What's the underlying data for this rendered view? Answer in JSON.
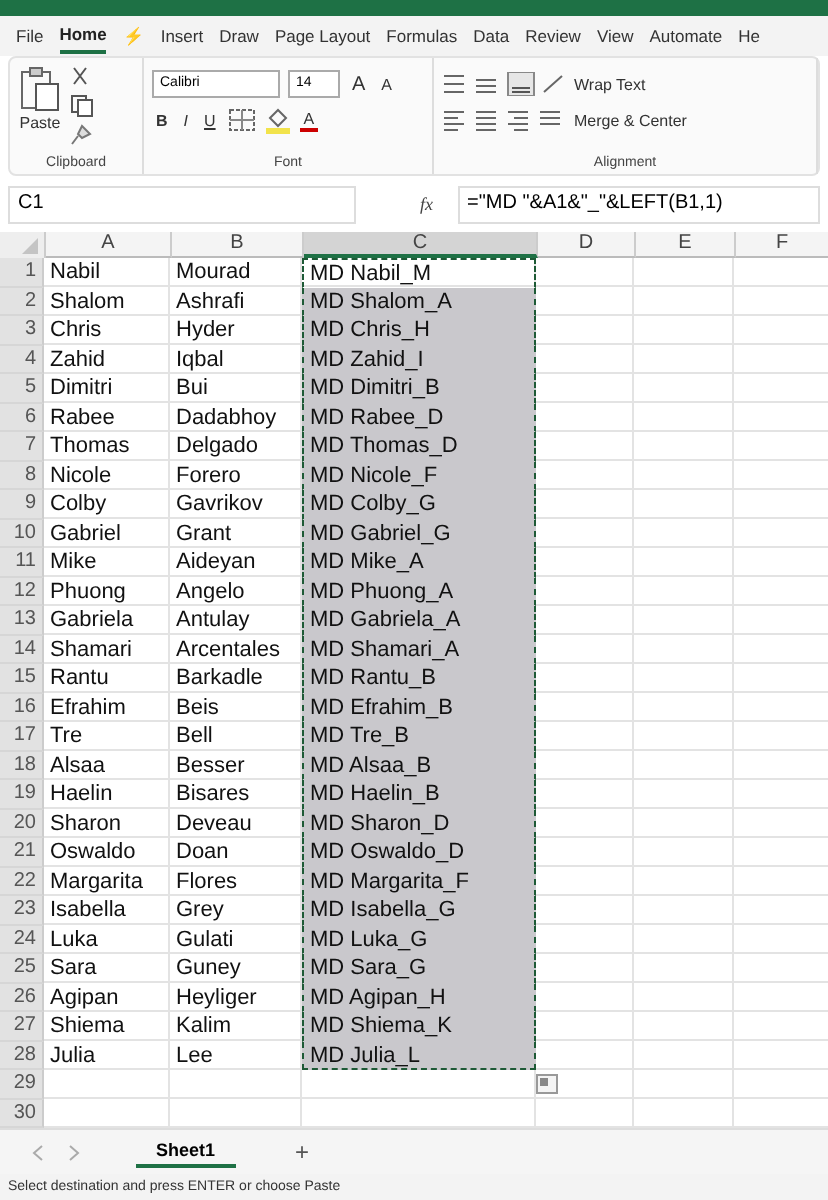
{
  "ribbon_tabs": [
    {
      "label": "File",
      "selected": false
    },
    {
      "label": "Home",
      "selected": true
    },
    {
      "label": "⚡",
      "selected": false
    },
    {
      "label": "Insert",
      "selected": false
    },
    {
      "label": "Draw",
      "selected": false
    },
    {
      "label": "Page Layout",
      "selected": false
    },
    {
      "label": "Formulas",
      "selected": false
    },
    {
      "label": "Data",
      "selected": false
    },
    {
      "label": "Review",
      "selected": false
    },
    {
      "label": "View",
      "selected": false
    },
    {
      "label": "Automate",
      "selected": false
    },
    {
      "label": "He",
      "selected": false
    }
  ],
  "clipboard": {
    "paste": "Paste",
    "group": "Clipboard"
  },
  "font": {
    "name": "Calibri",
    "size": "14",
    "grow": "A",
    "shrink": "A",
    "style_buttons": [
      "B",
      "I",
      "U"
    ],
    "color_button": "A",
    "group": "Font"
  },
  "alignment": {
    "wrap": "Wrap Text",
    "merge": "Merge & Center",
    "group": "Alignment"
  },
  "formula_bar": {
    "name_box": "C1",
    "fx": "fx",
    "formula": "=\"MD \"&A1&\"_\"&LEFT(B1,1)"
  },
  "columns": [
    {
      "label": "A",
      "selected": false
    },
    {
      "label": "B",
      "selected": false
    },
    {
      "label": "C",
      "selected": true
    },
    {
      "label": "D",
      "selected": false
    },
    {
      "label": "E",
      "selected": false
    },
    {
      "label": "F",
      "selected": false
    }
  ],
  "rows": [
    {
      "n": "1",
      "a": "Nabil",
      "b": "Mourad",
      "c": "MD Nabil_M",
      "selected": false
    },
    {
      "n": "2",
      "a": "Shalom",
      "b": "Ashrafi",
      "c": "MD Shalom_A",
      "selected": true
    },
    {
      "n": "3",
      "a": "Chris",
      "b": "Hyder",
      "c": "MD Chris_H",
      "selected": true
    },
    {
      "n": "4",
      "a": "Zahid",
      "b": "Iqbal",
      "c": "MD Zahid_I",
      "selected": true
    },
    {
      "n": "5",
      "a": "Dimitri",
      "b": "Bui",
      "c": "MD Dimitri_B",
      "selected": true
    },
    {
      "n": "6",
      "a": "Rabee",
      "b": "Dadabhoy",
      "c": "MD Rabee_D",
      "selected": true
    },
    {
      "n": "7",
      "a": "Thomas",
      "b": "Delgado",
      "c": "MD Thomas_D",
      "selected": true
    },
    {
      "n": "8",
      "a": "Nicole",
      "b": "Forero",
      "c": "MD Nicole_F",
      "selected": true
    },
    {
      "n": "9",
      "a": "Colby",
      "b": "Gavrikov",
      "c": "MD Colby_G",
      "selected": true
    },
    {
      "n": "10",
      "a": "Gabriel",
      "b": "Grant",
      "c": "MD Gabriel_G",
      "selected": true
    },
    {
      "n": "11",
      "a": "Mike",
      "b": "Aideyan",
      "c": "MD Mike_A",
      "selected": true
    },
    {
      "n": "12",
      "a": "Phuong",
      "b": "Angelo",
      "c": "MD Phuong_A",
      "selected": true
    },
    {
      "n": "13",
      "a": "Gabriela",
      "b": "Antulay",
      "c": "MD Gabriela_A",
      "selected": true
    },
    {
      "n": "14",
      "a": "Shamari",
      "b": "Arcentales",
      "c": "MD Shamari_A",
      "selected": true
    },
    {
      "n": "15",
      "a": "Rantu",
      "b": "Barkadle",
      "c": "MD Rantu_B",
      "selected": true
    },
    {
      "n": "16",
      "a": "Efrahim",
      "b": "Beis",
      "c": "MD Efrahim_B",
      "selected": true
    },
    {
      "n": "17",
      "a": "Tre",
      "b": "Bell",
      "c": "MD Tre_B",
      "selected": true
    },
    {
      "n": "18",
      "a": "Alsaa",
      "b": "Besser",
      "c": "MD Alsaa_B",
      "selected": true
    },
    {
      "n": "19",
      "a": "Haelin",
      "b": "Bisares",
      "c": "MD Haelin_B",
      "selected": true
    },
    {
      "n": "20",
      "a": "Sharon",
      "b": "Deveau",
      "c": "MD Sharon_D",
      "selected": true
    },
    {
      "n": "21",
      "a": "Oswaldo",
      "b": "Doan",
      "c": "MD Oswaldo_D",
      "selected": true
    },
    {
      "n": "22",
      "a": "Margarita",
      "b": "Flores",
      "c": "MD Margarita_F",
      "selected": true
    },
    {
      "n": "23",
      "a": "Isabella",
      "b": "Grey",
      "c": "MD Isabella_G",
      "selected": true
    },
    {
      "n": "24",
      "a": "Luka",
      "b": "Gulati",
      "c": "MD Luka_G",
      "selected": true
    },
    {
      "n": "25",
      "a": "Sara",
      "b": "Guney",
      "c": "MD Sara_G",
      "selected": true
    },
    {
      "n": "26",
      "a": "Agipan",
      "b": "Heyliger",
      "c": "MD Agipan_H",
      "selected": true
    },
    {
      "n": "27",
      "a": "Shiema",
      "b": "Kalim",
      "c": "MD Shiema_K",
      "selected": true
    },
    {
      "n": "28",
      "a": "Julia",
      "b": "Lee",
      "c": "MD Julia_L",
      "selected": true
    },
    {
      "n": "29"
    },
    {
      "n": "30"
    }
  ],
  "sheet_tabs": [
    {
      "label": "Sheet1",
      "selected": true
    }
  ],
  "add_sheet": "+",
  "status_bar": "Select destination and press ENTER or choose Paste"
}
